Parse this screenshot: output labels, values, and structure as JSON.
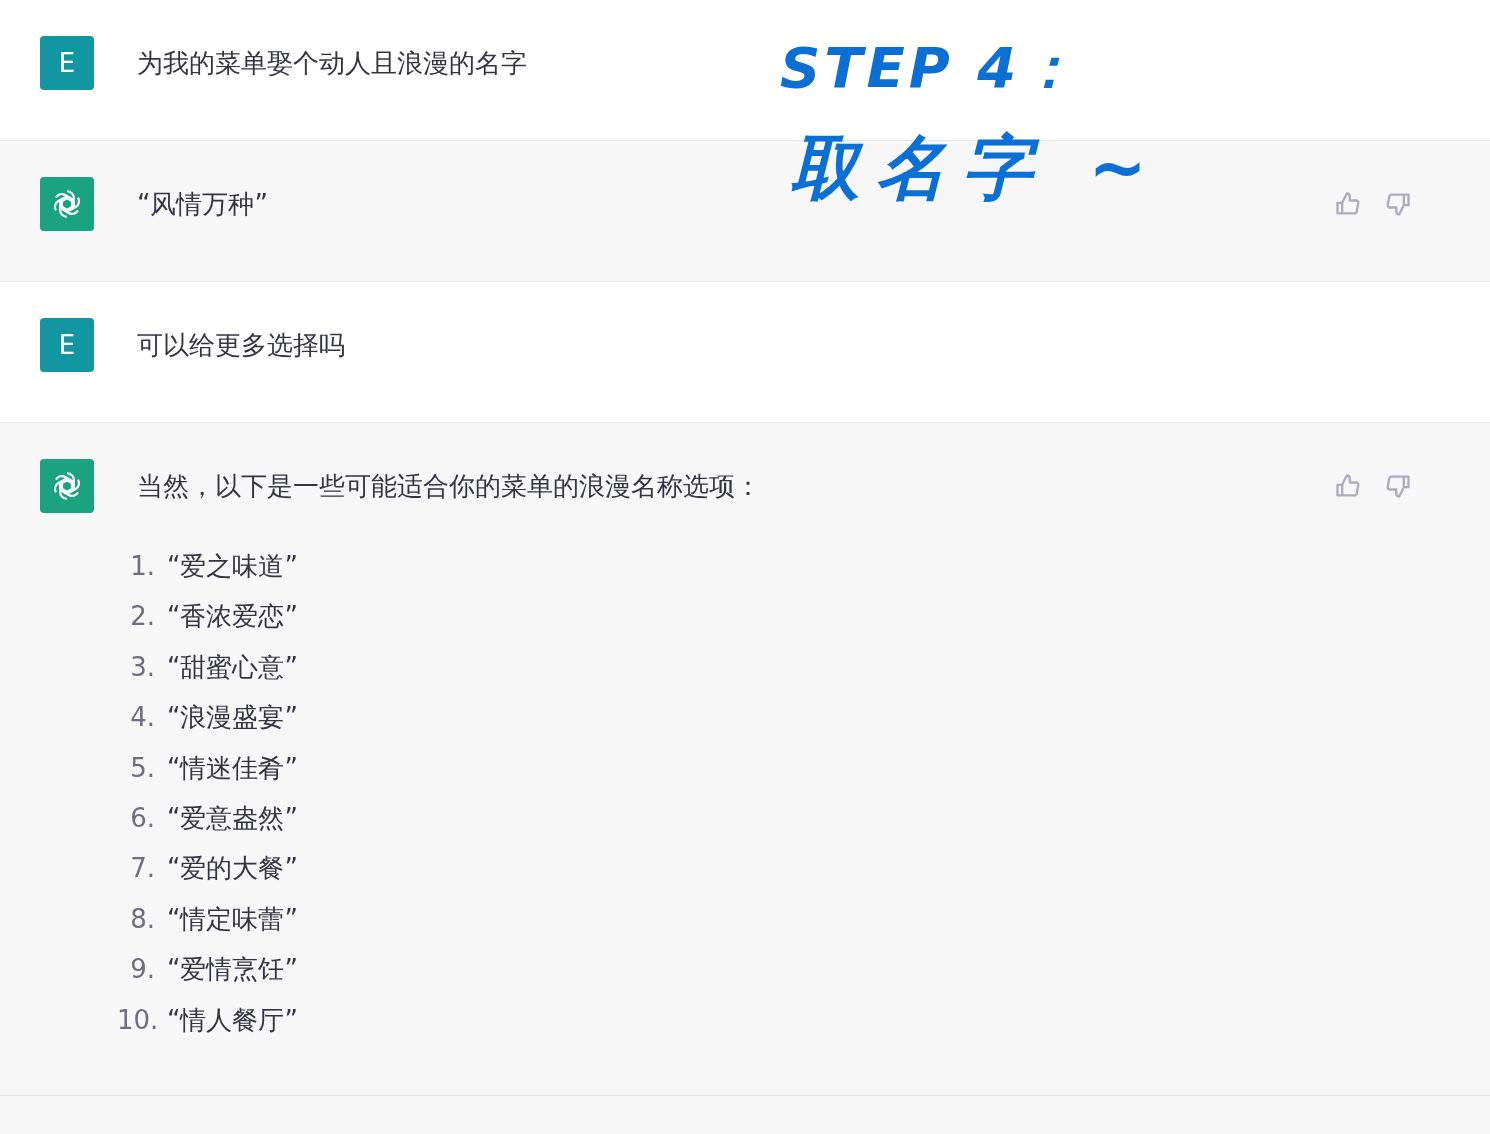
{
  "messages": [
    {
      "kind": "user",
      "avatar": "E",
      "paragraphs": [
        "为我的菜单娶个动人且浪漫的名字"
      ]
    },
    {
      "kind": "assistant",
      "paragraphs": [
        "“风情万种”"
      ]
    },
    {
      "kind": "user",
      "avatar": "E",
      "paragraphs": [
        "可以给更多选择吗"
      ]
    },
    {
      "kind": "assistant",
      "paragraphs": [
        "当然，以下是一些可能适合你的菜单的浪漫名称选项："
      ],
      "list": [
        {
          "number": "1.",
          "text": "“爱之味道”"
        },
        {
          "number": "2.",
          "text": "“香浓爱恋”"
        },
        {
          "number": "3.",
          "text": "“甜蜜心意”"
        },
        {
          "number": "4.",
          "text": "“浪漫盛宴”"
        },
        {
          "number": "5.",
          "text": "“情迷佳肴”"
        },
        {
          "number": "6.",
          "text": "“爱意盎然”"
        },
        {
          "number": "7.",
          "text": "“爱的大餐”"
        },
        {
          "number": "8.",
          "text": "“情定味蕾”"
        },
        {
          "number": "9.",
          "text": "“爱情烹饪”"
        },
        {
          "number": "10.",
          "text": "“情人餐厅”"
        }
      ]
    }
  ],
  "annotation": {
    "lines": [
      "STEP 4：",
      "取名字 ~"
    ]
  }
}
